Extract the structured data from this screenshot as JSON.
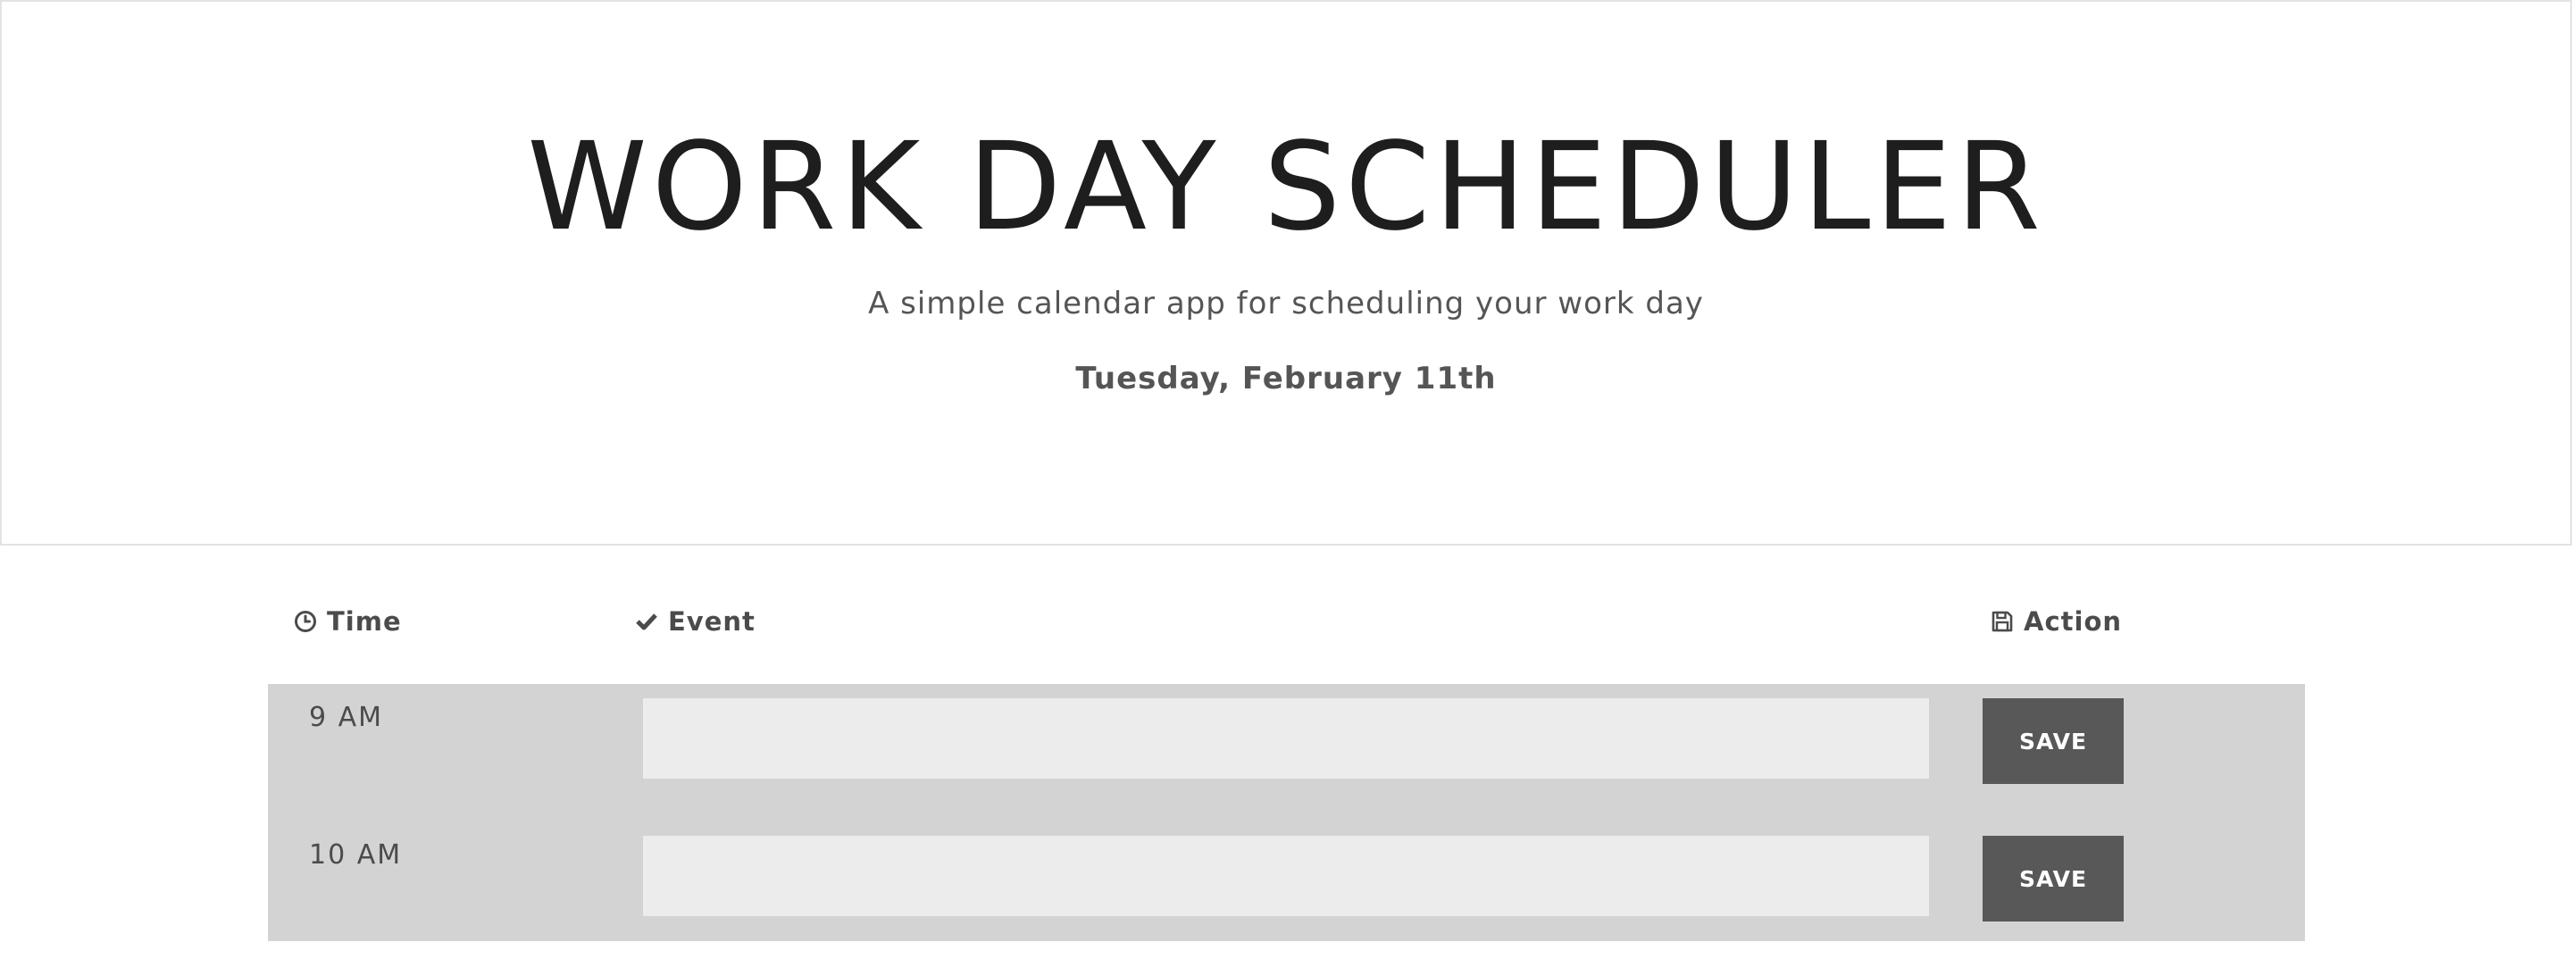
{
  "header": {
    "title": "WORK DAY SCHEDULER",
    "subtitle": "A simple calendar app for scheduling your work day",
    "current_date": "Tuesday, February 11th"
  },
  "columns": {
    "time": {
      "label": "Time",
      "icon": "clock-icon"
    },
    "event": {
      "label": "Event",
      "icon": "checkmark-icon"
    },
    "action": {
      "label": "Action",
      "icon": "floppy-disk-icon"
    }
  },
  "time_blocks": [
    {
      "hour_label": "9 AM",
      "event_value": "",
      "save_label": "SAVE"
    },
    {
      "hour_label": "10 AM",
      "event_value": "",
      "save_label": "SAVE"
    }
  ],
  "colors": {
    "row_background": "#d3d3d3",
    "input_background": "#ececed",
    "save_button": "#585858"
  }
}
